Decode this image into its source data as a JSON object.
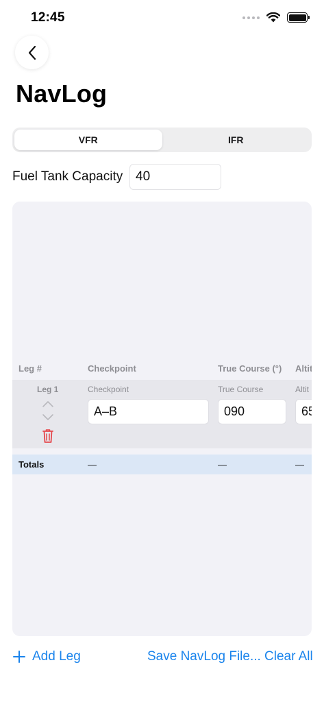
{
  "status_bar": {
    "time": "12:45"
  },
  "page": {
    "title": "NavLog"
  },
  "segments": {
    "vfr": "VFR",
    "ifr": "IFR",
    "selected": "VFR"
  },
  "fuel": {
    "label": "Fuel Tank Capacity",
    "value": "40"
  },
  "table": {
    "headers": {
      "leg": "Leg #",
      "checkpoint": "Checkpoint",
      "true_course": "True Course (°)",
      "altitude": "Altit"
    },
    "legs": [
      {
        "leg_label": "Leg 1",
        "checkpoint_label": "Checkpoint",
        "checkpoint_value": "A–B",
        "true_course_label": "True Course",
        "true_course_value": "090",
        "altitude_label": "Altit",
        "altitude_value": "65"
      }
    ],
    "totals": {
      "label": "Totals",
      "checkpoint": "—",
      "true_course": "—",
      "altitude": "—"
    }
  },
  "actions": {
    "add_leg": "Add Leg",
    "save": "Save NavLog File...",
    "clear": "Clear All"
  },
  "colors": {
    "accent": "#1a84ec",
    "delete": "#e5484d",
    "totals_bg": "#dbe7f6",
    "panel_bg": "#f2f2f7"
  }
}
